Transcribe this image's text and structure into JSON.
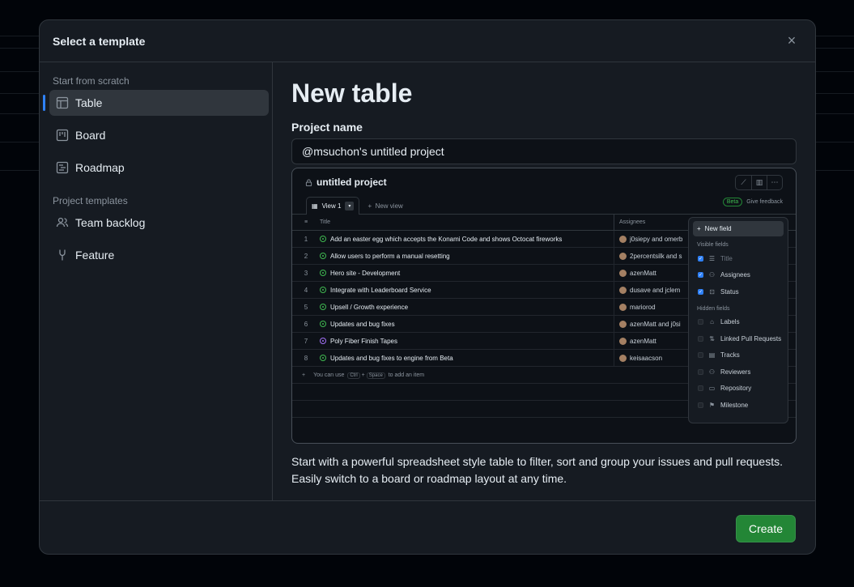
{
  "dialog": {
    "title": "Select a template",
    "close_label": "×"
  },
  "sidebar": {
    "section_scratch": "Start from scratch",
    "section_templates": "Project templates",
    "items": [
      {
        "label": "Table",
        "icon": "table-icon",
        "active": true
      },
      {
        "label": "Board",
        "icon": "board-icon",
        "active": false
      },
      {
        "label": "Roadmap",
        "icon": "roadmap-icon",
        "active": false
      },
      {
        "label": "Team backlog",
        "icon": "people-icon",
        "active": false
      },
      {
        "label": "Feature",
        "icon": "feature-icon",
        "active": false
      }
    ]
  },
  "main": {
    "title": "New table",
    "project_name_label": "Project name",
    "project_name_value": "@msuchon's untitled project",
    "description": "Start with a powerful spreadsheet style table to filter, sort and group your issues and pull requests. Easily switch to a board or roadmap layout at any time."
  },
  "preview": {
    "title": "untitled project",
    "tab": "View 1",
    "new_view": "New view",
    "beta": "Beta",
    "feedback": "Give feedback",
    "col_title": "Title",
    "col_assignees": "Assignees",
    "rows": [
      {
        "num": "1",
        "title": "Add an easter egg which accepts the Konami Code and shows Octocat fireworks",
        "assignee": "j0siepy and omerb",
        "status": "open"
      },
      {
        "num": "2",
        "title": "Allow users to perform a manual resetting",
        "assignee": "2percentsilk and s",
        "status": "open"
      },
      {
        "num": "3",
        "title": "Hero site - Development",
        "assignee": "azenMatt",
        "status": "open"
      },
      {
        "num": "4",
        "title": "Integrate with Leaderboard Service",
        "assignee": "dusave and jclem",
        "status": "open"
      },
      {
        "num": "5",
        "title": "Upsell / Growth experience",
        "assignee": "mariorod",
        "status": "open"
      },
      {
        "num": "6",
        "title": "Updates and bug fixes",
        "assignee": "azenMatt and j0si",
        "status": "open"
      },
      {
        "num": "7",
        "title": "Poly Fiber Finish Tapes",
        "assignee": "azenMatt",
        "status": "draft"
      },
      {
        "num": "8",
        "title": "Updates and bug fixes to engine from Beta",
        "assignee": "keisaacson",
        "status": "open"
      }
    ],
    "add_item_prefix": "You can use",
    "add_item_key1": "Ctrl",
    "add_item_plus": "+",
    "add_item_key2": "Space",
    "add_item_suffix": "to add an item",
    "menu": {
      "new_field": "New field",
      "visible_label": "Visible fields",
      "visible": [
        "Title",
        "Assignees",
        "Status"
      ],
      "hidden_label": "Hidden fields",
      "hidden": [
        "Labels",
        "Linked Pull Requests",
        "Tracks",
        "Reviewers",
        "Repository",
        "Milestone"
      ]
    }
  },
  "footer": {
    "create_label": "Create"
  },
  "colors": {
    "accent": "#2f81f7",
    "primary_button": "#238636",
    "background": "#161b22"
  }
}
